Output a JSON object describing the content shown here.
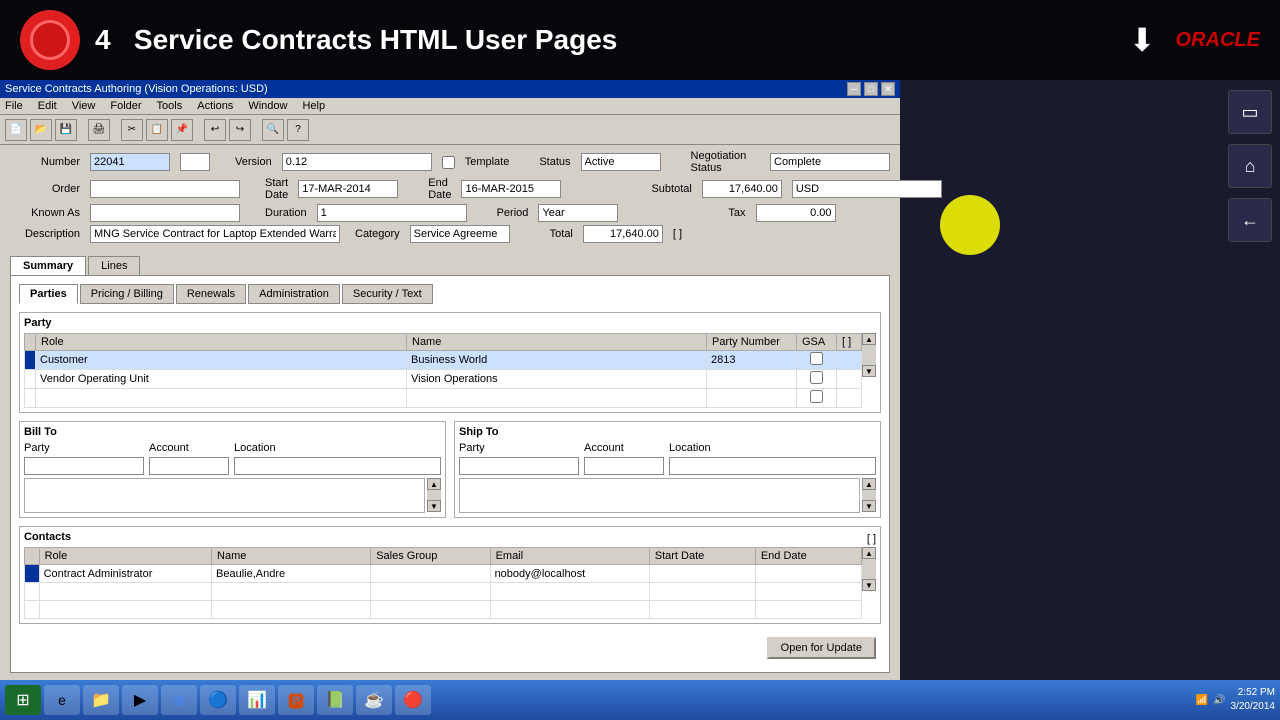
{
  "title_overlay": {
    "number_prefix": "4",
    "title": "Service Contracts HTML User Pages",
    "download_icon": "⬇",
    "oracle_label": "ORACLE"
  },
  "app_window": {
    "title": "Service Contracts Authoring (Vision Operations: USD)",
    "controls": [
      "─",
      "□",
      "✕"
    ]
  },
  "menu": {
    "items": [
      "File",
      "Edit",
      "View",
      "Folder",
      "Tools",
      "Actions",
      "Window",
      "Help"
    ]
  },
  "form": {
    "number_label": "Number",
    "number_value": "22041",
    "version_label": "Version",
    "version_value": "0.12",
    "template_label": "Template",
    "status_label": "Status",
    "status_value": "Active",
    "negotiation_status_label": "Negotiation Status",
    "negotiation_status_value": "Complete",
    "order_label": "Order",
    "start_date_label": "Start Date",
    "start_date_value": "17-MAR-2014",
    "end_date_label": "End Date",
    "end_date_value": "16-MAR-2015",
    "subtotal_label": "Subtotal",
    "subtotal_value": "17,640.00",
    "currency_value": "USD",
    "known_as_label": "Known As",
    "duration_label": "Duration",
    "duration_value": "1",
    "period_label": "Period",
    "period_value": "Year",
    "tax_label": "Tax",
    "tax_value": "0.00",
    "description_label": "Description",
    "description_value": "MNG Service Contract for Laptop Extended Warranty",
    "category_label": "Category",
    "category_value": "Service Agreeme",
    "total_label": "Total",
    "total_value": "17,640.00"
  },
  "main_tabs": {
    "items": [
      "Summary",
      "Lines"
    ],
    "active": "Summary"
  },
  "inner_tabs": {
    "items": [
      "Parties",
      "Pricing / Billing",
      "Renewals",
      "Administration",
      "Security / Text"
    ],
    "active": "Parties"
  },
  "party_section": {
    "title": "Party",
    "columns": [
      "Role",
      "Name",
      "Party Number",
      "GSA",
      ""
    ],
    "rows": [
      {
        "role": "Customer",
        "name": "Business World",
        "party_number": "2813",
        "gsa": false,
        "selected": true
      },
      {
        "role": "Vendor Operating Unit",
        "name": "Vision Operations",
        "party_number": "",
        "gsa": false,
        "selected": false
      },
      {
        "role": "",
        "name": "",
        "party_number": "",
        "gsa": false,
        "selected": false
      }
    ]
  },
  "bill_to": {
    "title": "Bill To",
    "columns": [
      "Party",
      "Account",
      "Location"
    ],
    "party_value": "",
    "account_value": "",
    "location_value": ""
  },
  "ship_to": {
    "title": "Ship To",
    "columns": [
      "Party",
      "Account",
      "Location"
    ],
    "party_value": "",
    "account_value": "",
    "location_value": ""
  },
  "contacts_section": {
    "title": "Contacts",
    "columns": [
      "Role",
      "Name",
      "Sales Group",
      "Email",
      "Start Date",
      "End Date",
      ""
    ],
    "rows": [
      {
        "role": "Contract Administrator",
        "name": "Beaulie,Andre",
        "sales_group": "",
        "email": "nobody@localhost",
        "start_date": "",
        "end_date": "",
        "selected": true
      },
      {
        "role": "",
        "name": "",
        "sales_group": "",
        "email": "",
        "start_date": "",
        "end_date": "",
        "selected": false
      },
      {
        "role": "",
        "name": "",
        "sales_group": "",
        "email": "",
        "start_date": "",
        "end_date": "",
        "selected": false
      }
    ]
  },
  "buttons": {
    "open_for_update": "Open for Update"
  },
  "taskbar": {
    "time": "2:52 PM",
    "date": "3/20/2014",
    "apps": [
      "⊞",
      "IE",
      "📁",
      "▶",
      "🌐",
      "🔵",
      "📊",
      "🅿",
      "📗",
      "☕",
      "🔴"
    ]
  }
}
